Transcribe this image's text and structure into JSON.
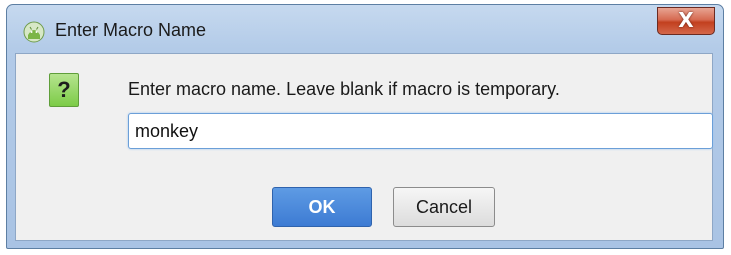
{
  "window": {
    "title": "Enter Macro Name",
    "close_label": "X"
  },
  "dialog": {
    "icon_glyph": "?",
    "message": "Enter macro name. Leave blank if macro is temporary.",
    "input_value": "monkey"
  },
  "buttons": {
    "ok_label": "OK",
    "cancel_label": "Cancel"
  },
  "icons": {
    "title": "android-app-icon",
    "message": "question-icon",
    "close": "close-icon"
  },
  "colors": {
    "accent": "#3d7bd3",
    "question_icon": "#7ccb47",
    "close_button": "#c2401f"
  }
}
